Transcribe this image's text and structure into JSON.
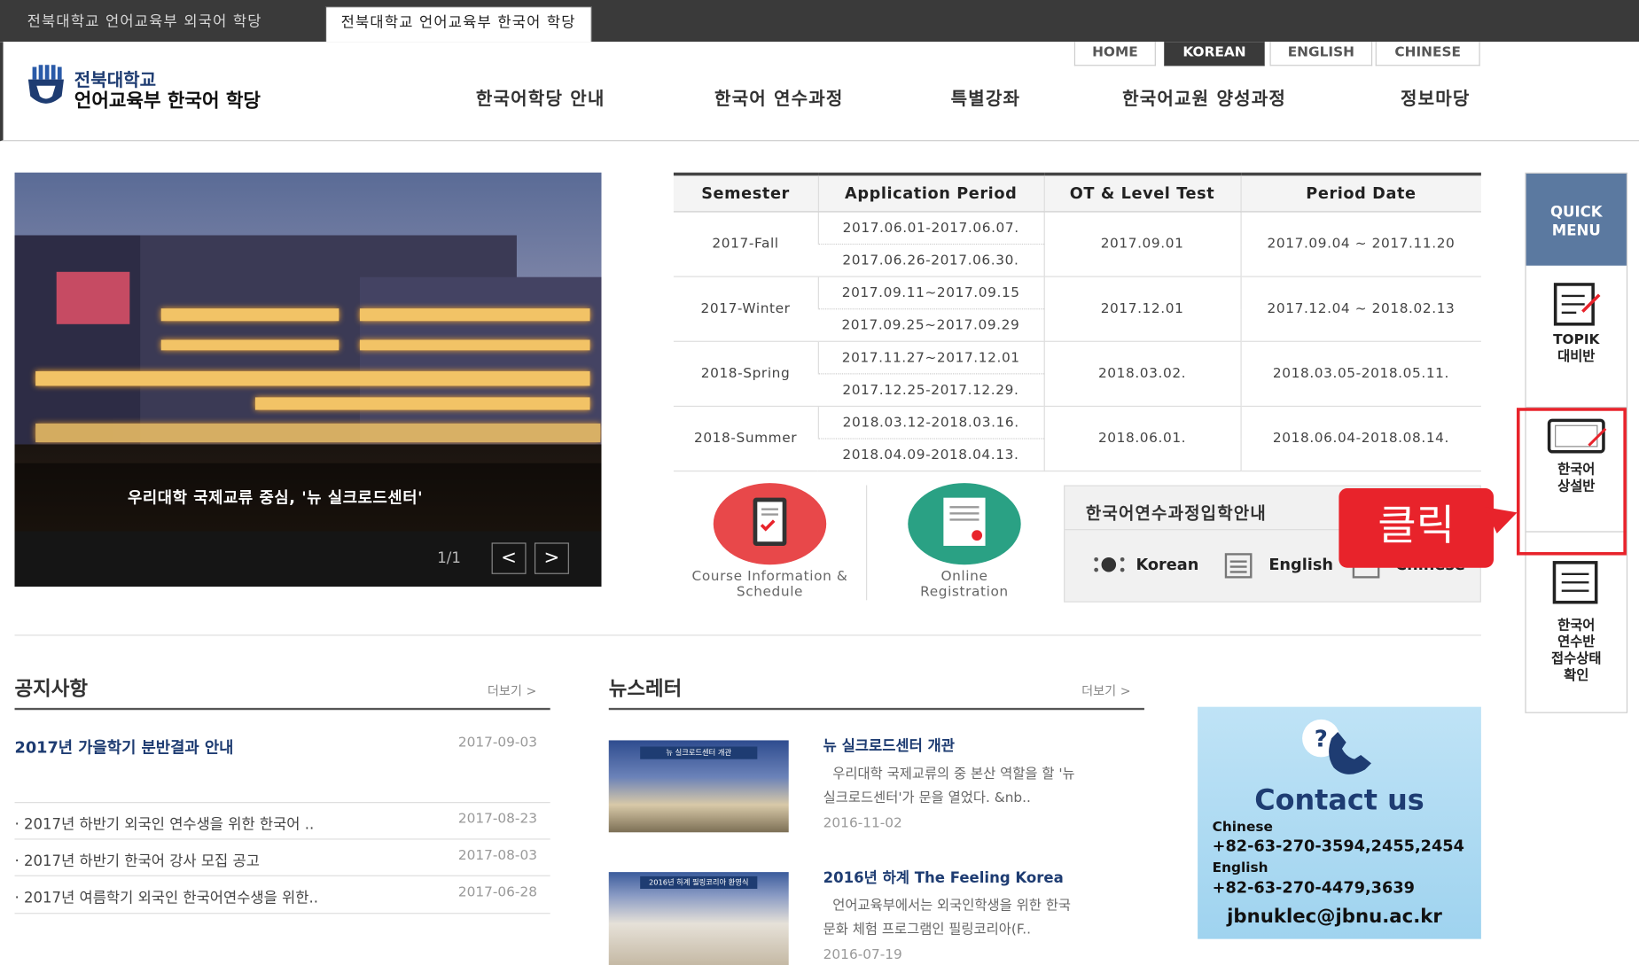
{
  "tabs": [
    "전북대학교 언어교육부 외국어 학당",
    "전북대학교 언어교육부 한국어 학당"
  ],
  "logo": {
    "line1": "전북대학교",
    "line2": "언어교육부 한국어 학당"
  },
  "lang_menu": [
    "HOME",
    "KOREAN",
    "ENGLISH",
    "CHINESE"
  ],
  "gnb": [
    "한국어학당 안내",
    "한국어 연수과정",
    "특별강좌",
    "한국어교원 양성과정",
    "정보마당"
  ],
  "slider": {
    "caption": "우리대학 국제교류 중심, '뉴 실크로드센터'",
    "counter": "1/1",
    "prev": "<",
    "next": ">"
  },
  "schedule": {
    "headers": [
      "Semester",
      "Application Period",
      "OT & Level Test",
      "Period Date"
    ],
    "rows": [
      {
        "semester": "2017-Fall",
        "apps": [
          "2017.06.01-2017.06.07.",
          "2017.06.26-2017.06.30."
        ],
        "ot": "2017.09.01",
        "period": "2017.09.04 ~ 2017.11.20"
      },
      {
        "semester": "2017-Winter",
        "apps": [
          "2017.09.11~2017.09.15",
          "2017.09.25~2017.09.29"
        ],
        "ot": "2017.12.01",
        "period": "2017.12.04 ~ 2018.02.13"
      },
      {
        "semester": "2018-Spring",
        "apps": [
          "2017.11.27~2017.12.01",
          "2017.12.25-2017.12.29."
        ],
        "ot": "2018.03.02.",
        "period": "2018.03.05-2018.05.11."
      },
      {
        "semester": "2018-Summer",
        "apps": [
          "2018.03.12-2018.03.16.",
          "2018.04.09-2018.04.13."
        ],
        "ot": "2018.06.01.",
        "period": "2018.06.04-2018.08.14."
      }
    ]
  },
  "buttons": {
    "course": {
      "line1": "Course Information &",
      "line2": "Schedule"
    },
    "online": {
      "line1": "Online",
      "line2": "Registration"
    }
  },
  "admission": {
    "title": "한국어연수과정입학안내",
    "korean": "Korean",
    "english": "English",
    "chinese": "Chinese"
  },
  "callout": "클릭",
  "quick_menu": {
    "title_line1": "QUICK",
    "title_line2": "MENU",
    "topik_1": "TOPIK",
    "topik_2": "대비반",
    "consult_1": "한국어",
    "consult_2": "상설반",
    "status_1": "한국어",
    "status_2": "연수반",
    "status_3": "접수상태",
    "status_4": "확인"
  },
  "notice": {
    "title": "공지사항",
    "more": "더보기 >",
    "featured": {
      "title": "2017년 가을학기 분반결과 안내",
      "date": "2017-09-03"
    },
    "items": [
      {
        "title": "2017년 하반기 외국인 연수생을 위한 한국어 ..",
        "date": "2017-08-23"
      },
      {
        "title": "2017년 하반기 한국어 강사 모집 공고",
        "date": "2017-08-03"
      },
      {
        "title": "2017년 여름학기 외국인 한국어연수생을 위한..",
        "date": "2017-06-28"
      }
    ]
  },
  "newsletter": {
    "title": "뉴스레터",
    "more": "더보기 >",
    "items": [
      {
        "title": "뉴 실크로드센터 개관",
        "desc1": "우리대학 국제교류의 중 본산 역할을 할 '뉴",
        "desc2": "실크로드센터'가 문을 열었다. &nb..",
        "date": "2016-11-02",
        "img_text": "뉴 실크로드센터 개관"
      },
      {
        "title": "2016년 하계 The Feeling Korea",
        "desc1": "언어교육부에서는 외국인학생을 위한 한국",
        "desc2": "문화 체험 프로그램인 필링코리아(F..",
        "date": "2016-07-19",
        "img_text": "2016년 하계 필링코리아 환영식"
      }
    ]
  },
  "contact": {
    "title": "Contact us",
    "chinese_label": "Chinese",
    "chinese_phone": "+82-63-270-3594,2455,2454",
    "english_label": "English",
    "english_phone": "+82-63-270-4479,3639",
    "email": "jbnuklec@jbnu.ac.kr"
  },
  "colors": {
    "dark": "#3a3a3a",
    "accent_red": "#e8232b",
    "navy": "#1e3c72",
    "quick_header": "#5b79a0",
    "circle_red": "#e8484a",
    "circle_green": "#2aa184",
    "contact_bg": "#a8d8f2"
  }
}
